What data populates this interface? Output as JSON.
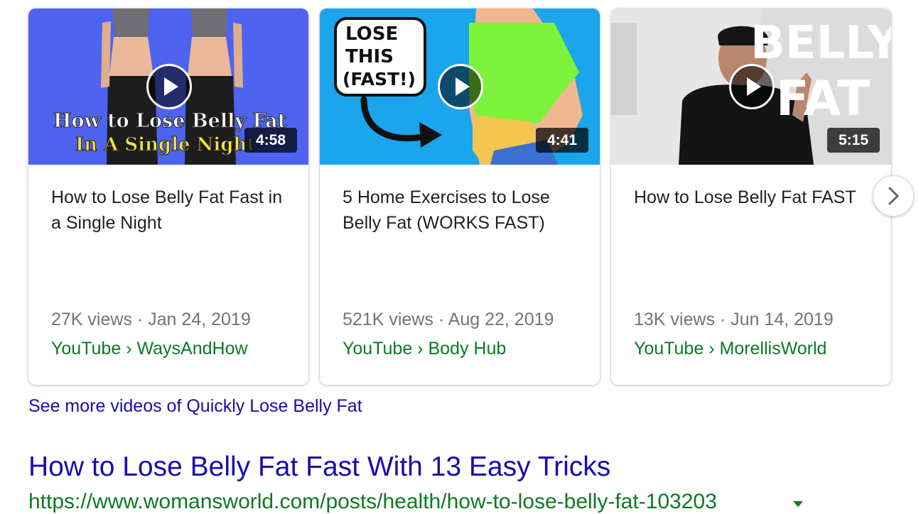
{
  "videos": [
    {
      "thumb_text": [
        "How to Lose Belly Fat",
        "In A Single Night"
      ],
      "duration": "4:58",
      "title": "How to Lose Belly Fat Fast in a Single Night",
      "meta": "27K views · Jan 24, 2019",
      "source": "YouTube › WaysAndHow"
    },
    {
      "thumb_text": [
        "LOSE",
        "THIS",
        "(FAST!)"
      ],
      "duration": "4:41",
      "title": "5 Home Exercises to Lose Belly Fat (WORKS FAST)",
      "meta": "521K views · Aug 22, 2019",
      "source": "YouTube › Body Hub"
    },
    {
      "thumb_text": [
        "BELLY",
        "FAT"
      ],
      "duration": "5:15",
      "title": "How to Lose Belly Fat FAST",
      "meta": "13K views · Jun 14, 2019",
      "source": "YouTube › MorellisWorld"
    }
  ],
  "see_more": "See more videos of Quickly Lose Belly Fat",
  "result": {
    "title": "How to Lose Belly Fat Fast With 13 Easy Tricks",
    "url": "https://www.womansworld.com/posts/health/how-to-lose-belly-fat-103203"
  },
  "icons": {
    "play": "play-icon",
    "next": "chevron-right-icon",
    "caret": "caret-down-icon"
  },
  "colors": {
    "link_blue": "#1a0dab",
    "source_green": "#0b7a24",
    "meta_gray": "#70757a",
    "title_text": "#202124",
    "thumb1_bg": "#4e63f0",
    "thumb2_bg": "#1ba5ec",
    "thumb2_shirt": "#7df23a"
  }
}
